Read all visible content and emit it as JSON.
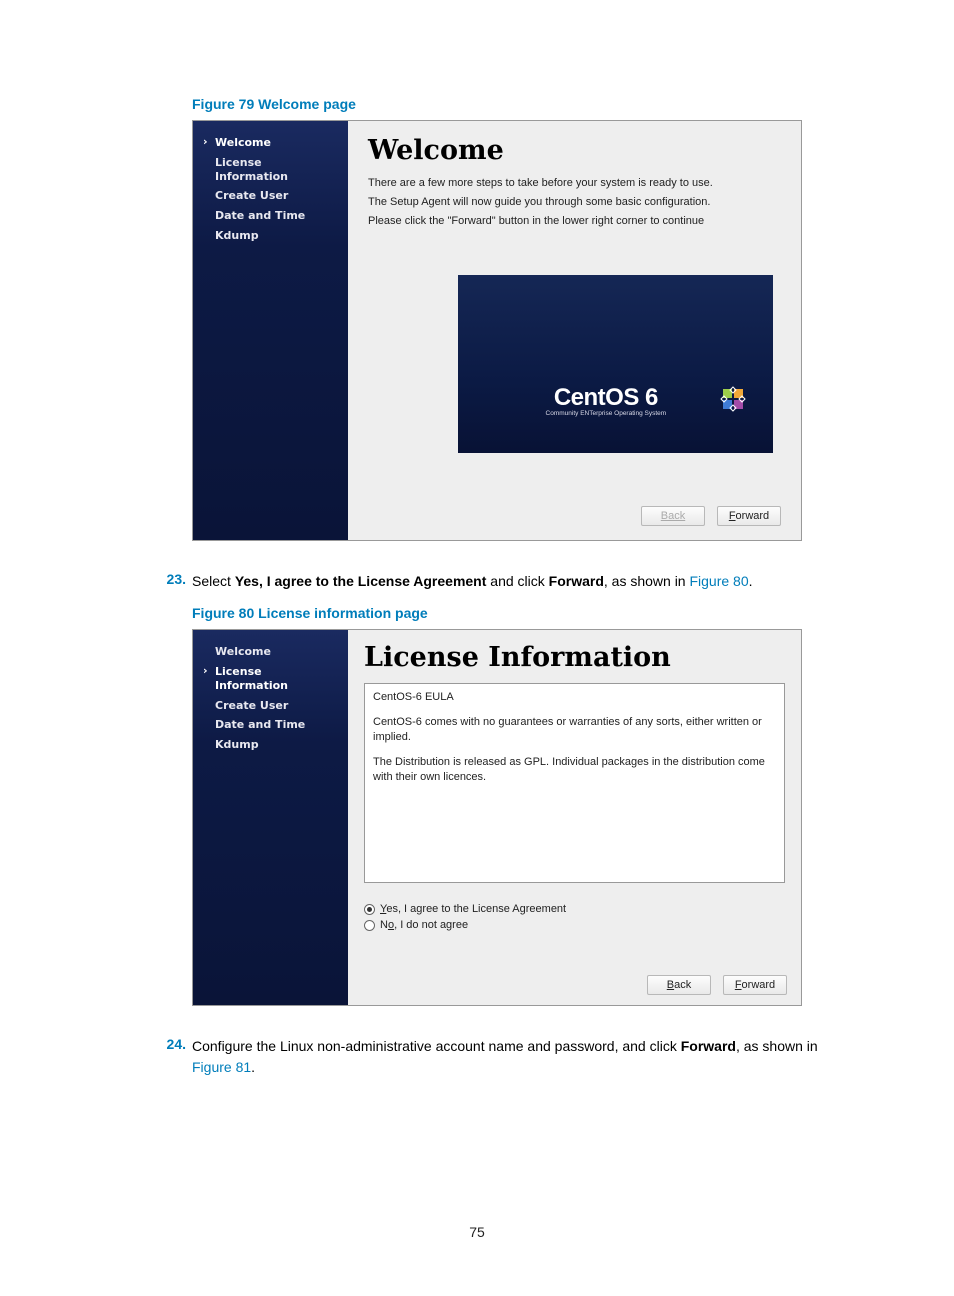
{
  "figures": {
    "f79": "Figure 79 Welcome page",
    "f80": "Figure 80 License information page"
  },
  "steps": {
    "s23": {
      "num": "23.",
      "pre": "Select ",
      "bold1": "Yes, I agree to the License Agreement",
      "mid": " and click ",
      "bold2": "Forward",
      "post": ", as shown in ",
      "link": "Figure 80",
      "end": "."
    },
    "s24": {
      "num": "24.",
      "pre": "Configure the Linux non-administrative account name and password, and click ",
      "bold1": "Forward",
      "post": ", as shown in ",
      "link": "Figure 81",
      "end": "."
    }
  },
  "shot1": {
    "sidebar": [
      {
        "label": "Welcome",
        "active": true
      },
      {
        "label": "License Information",
        "active": false
      },
      {
        "label": "Create User",
        "active": false
      },
      {
        "label": "Date and Time",
        "active": false
      },
      {
        "label": "Kdump",
        "active": false
      }
    ],
    "heading": "Welcome",
    "paras": [
      "There are a few more steps to take before your system is ready to use.",
      "The Setup Agent will now guide you through some basic configuration.",
      "Please click the \"Forward\" button in the lower right corner to continue"
    ],
    "brand": {
      "big": "CentOS 6",
      "small": "Community ENTerprise Operating System"
    },
    "back": "Back",
    "forward_u": "F",
    "forward_rest": "orward"
  },
  "shot2": {
    "sidebar": [
      {
        "label": "Welcome",
        "active": false
      },
      {
        "label": "License Information",
        "active": true
      },
      {
        "label": "Create User",
        "active": false
      },
      {
        "label": "Date and Time",
        "active": false
      },
      {
        "label": "Kdump",
        "active": false
      }
    ],
    "heading": "License Information",
    "license": {
      "title": "CentOS-6 EULA",
      "p1": "CentOS-6 comes with no guarantees or warranties of any sorts, either written or implied.",
      "p2": "The Distribution is released as GPL. Individual packages in the distribution come with their own licences."
    },
    "radio_yes_u": "Y",
    "radio_yes_rest": "es, I agree to the License Agreement",
    "radio_no_pre": "N",
    "radio_no_u": "o",
    "radio_no_rest": ", I do not agree",
    "back_u": "B",
    "back_rest": "ack",
    "forward_u": "F",
    "forward_rest": "orward"
  },
  "page_number": "75"
}
